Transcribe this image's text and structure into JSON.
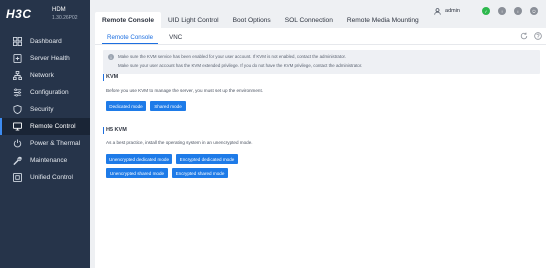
{
  "brand": {
    "logo": "H3C",
    "product": "HDM",
    "version": "1.30.26P02"
  },
  "sidebar": {
    "items": [
      {
        "label": "Dashboard",
        "icon": "dashboard-icon"
      },
      {
        "label": "Server Health",
        "icon": "server-health-icon"
      },
      {
        "label": "Network",
        "icon": "network-icon"
      },
      {
        "label": "Configuration",
        "icon": "configuration-icon"
      },
      {
        "label": "Security",
        "icon": "security-icon"
      },
      {
        "label": "Remote Control",
        "icon": "remote-control-icon",
        "active": true
      },
      {
        "label": "Power & Thermal",
        "icon": "power-icon"
      },
      {
        "label": "Maintenance",
        "icon": "maintenance-icon"
      },
      {
        "label": "Unified Control",
        "icon": "unified-control-icon"
      }
    ]
  },
  "tabs": [
    {
      "label": "Remote Console",
      "active": true
    },
    {
      "label": "UID Light Control"
    },
    {
      "label": "Boot Options"
    },
    {
      "label": "SOL Connection"
    },
    {
      "label": "Remote Media Mounting"
    }
  ],
  "user": {
    "name": "admin",
    "status_colors": [
      "#2db84d",
      "#8a8f98",
      "#8a8f98",
      "#8a8f98"
    ]
  },
  "subtabs": [
    {
      "label": "Remote Console",
      "active": true
    },
    {
      "label": "VNC"
    }
  ],
  "notice": {
    "line1": "Make sure the KVM service has been enabled for your user account. If KVM is not enabled, contact the administrator.",
    "line2": "Make sure your user account has the KVM extended privilege. If you do not have the KVM privilege, contact the administrator."
  },
  "kvm": {
    "title": "KVM",
    "description": "Before you use KVM to manage the server, you must set up the environment.",
    "buttons": [
      "Dedicated mode",
      "Shared mode"
    ]
  },
  "h5kvm": {
    "title": "H5 KVM",
    "description": "As a best practice, install the operating system in an unencrypted mode.",
    "buttons": [
      "Unencrypted dedicated mode",
      "Encrypted dedicated mode",
      "Unencrypted shared mode",
      "Encrypted shared mode"
    ]
  },
  "colors": {
    "sidebar_bg": "#26344a",
    "accent": "#1e7be8"
  }
}
